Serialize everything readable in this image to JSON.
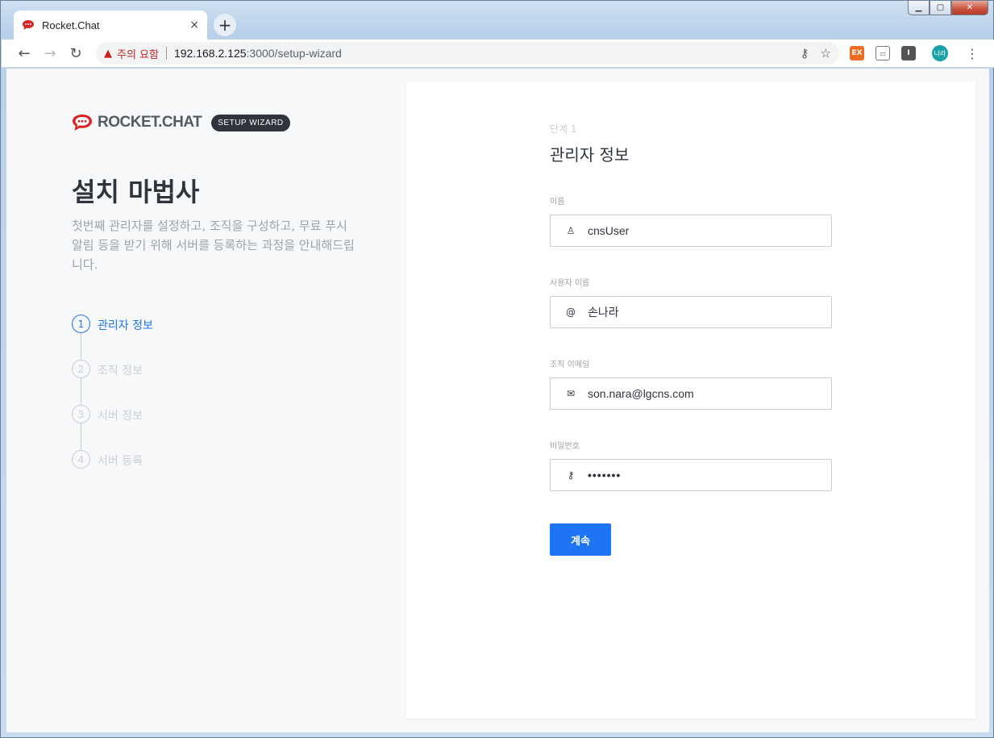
{
  "browser": {
    "tab_title": "Rocket.Chat",
    "tab_close": "×",
    "new_tab": "+",
    "security_warning": "주의 요함",
    "url_host": "192.168.2.125",
    "url_path": ":3000/setup-wizard",
    "profile_label": "나라",
    "window_controls": {
      "minimize": "▁",
      "maximize": "▢",
      "close": "✕"
    }
  },
  "brand": {
    "name": "ROCKET.CHAT",
    "badge": "SETUP WIZARD",
    "accent_color": "#db2323"
  },
  "left": {
    "title": "설치 마법사",
    "description": "첫번째 관리자를 설정하고, 조직을 구성하고, 무료 푸시 알림 등을 받기 위해 서버를 등록하는 과정을 안내해드립니다.",
    "steps": [
      {
        "number": "1",
        "label": "관리자 정보",
        "active": true
      },
      {
        "number": "2",
        "label": "조직 정보",
        "active": false
      },
      {
        "number": "3",
        "label": "서버 정보",
        "active": false
      },
      {
        "number": "4",
        "label": "서버 등록",
        "active": false
      }
    ]
  },
  "form": {
    "step_caption": "단계 1",
    "title": "관리자 정보",
    "fields": [
      {
        "label": "이름",
        "value": "cnsUser",
        "icon": "user-icon"
      },
      {
        "label": "사용자 이름",
        "value": "손나라",
        "icon": "at-icon"
      },
      {
        "label": "조직 이메일",
        "value": "son.nara@lgcns.com",
        "icon": "mail-icon"
      },
      {
        "label": "비밀번호",
        "value": "•••••••",
        "icon": "key-icon"
      }
    ],
    "continue_label": "계속",
    "primary_color": "#1d74f5"
  }
}
